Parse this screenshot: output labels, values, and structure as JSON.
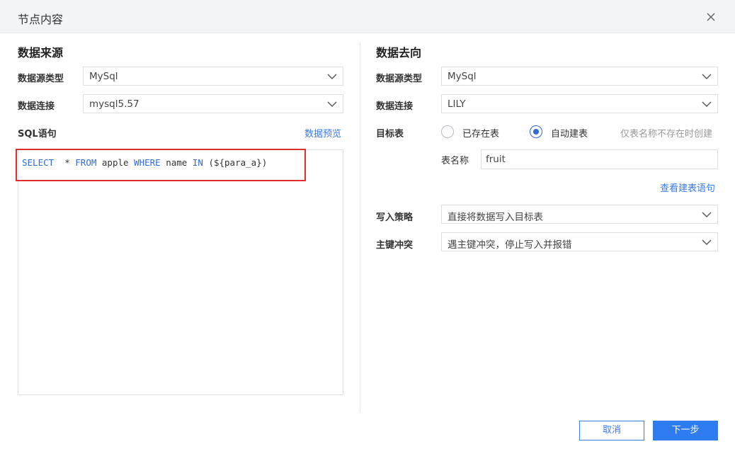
{
  "dialog": {
    "title": "节点内容"
  },
  "source": {
    "heading": "数据来源",
    "type_label": "数据源类型",
    "type_value": "MySql",
    "conn_label": "数据连接",
    "conn_value": "mysql5.57",
    "sql_label": "SQL语句",
    "preview_link": "数据预览",
    "sql": {
      "t1": "SELECT",
      "t2": "  * ",
      "t3": "FROM",
      "t4": " apple ",
      "t5": "WHERE",
      "t6": " name ",
      "t7": "IN",
      "t8": " (${para_a})"
    }
  },
  "dest": {
    "heading": "数据去向",
    "type_label": "数据源类型",
    "type_value": "MySql",
    "conn_label": "数据连接",
    "conn_value": "LILY",
    "target_label": "目标表",
    "radio_existing": "已存在表",
    "radio_auto": "自动建表",
    "hint": "仅表名称不存在时创建",
    "table_name_label": "表名称",
    "table_name_value": "fruit",
    "view_sql_link": "查看建表语句",
    "write_label": "写入策略",
    "write_value": "直接将数据写入目标表",
    "conflict_label": "主键冲突",
    "conflict_value": "遇主键冲突，停止写入并报错"
  },
  "footer": {
    "cancel": "取消",
    "next": "下一步"
  },
  "colors": {
    "accent": "#2f7bf0",
    "keyword": "#2e6bd8",
    "highlight": "#e0302c"
  }
}
